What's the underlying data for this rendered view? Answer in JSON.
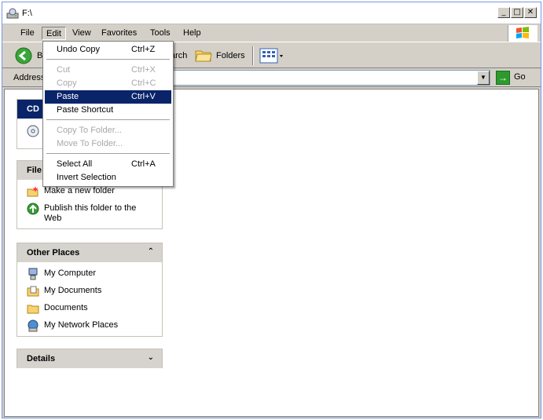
{
  "window": {
    "title": "F:\\"
  },
  "menubar": {
    "items": [
      "File",
      "Edit",
      "View",
      "Favorites",
      "Tools",
      "Help"
    ]
  },
  "toolbar": {
    "back_partial": "B",
    "search_partial": "arch",
    "folders": "Folders"
  },
  "address": {
    "label": "Address",
    "value": "",
    "go": "Go"
  },
  "edit_menu": {
    "items": [
      {
        "label": "Undo Copy",
        "shortcut": "Ctrl+Z",
        "enabled": true
      },
      {
        "label": "Cut",
        "shortcut": "Ctrl+X",
        "enabled": false
      },
      {
        "label": "Copy",
        "shortcut": "Ctrl+C",
        "enabled": false
      },
      {
        "label": "Paste",
        "shortcut": "Ctrl+V",
        "enabled": true,
        "highlighted": true
      },
      {
        "label": "Paste Shortcut",
        "shortcut": "",
        "enabled": true
      },
      {
        "label": "Copy To Folder...",
        "shortcut": "",
        "enabled": false
      },
      {
        "label": "Move To Folder...",
        "shortcut": "",
        "enabled": false
      },
      {
        "label": "Select All",
        "shortcut": "Ctrl+A",
        "enabled": true
      },
      {
        "label": "Invert Selection",
        "shortcut": "",
        "enabled": true
      }
    ]
  },
  "panels": {
    "cd": {
      "title": "CD"
    },
    "file": {
      "title": "File",
      "tasks": [
        "Make a new folder",
        "Publish this folder to the Web"
      ]
    },
    "other": {
      "title": "Other Places",
      "items": [
        "My Computer",
        "My Documents",
        "Documents",
        "My Network Places"
      ]
    },
    "details": {
      "title": "Details"
    }
  },
  "colors": {
    "highlight": "#0a246a",
    "panel_header": "#d6d3ce",
    "window_face": "#d4d0c8"
  }
}
